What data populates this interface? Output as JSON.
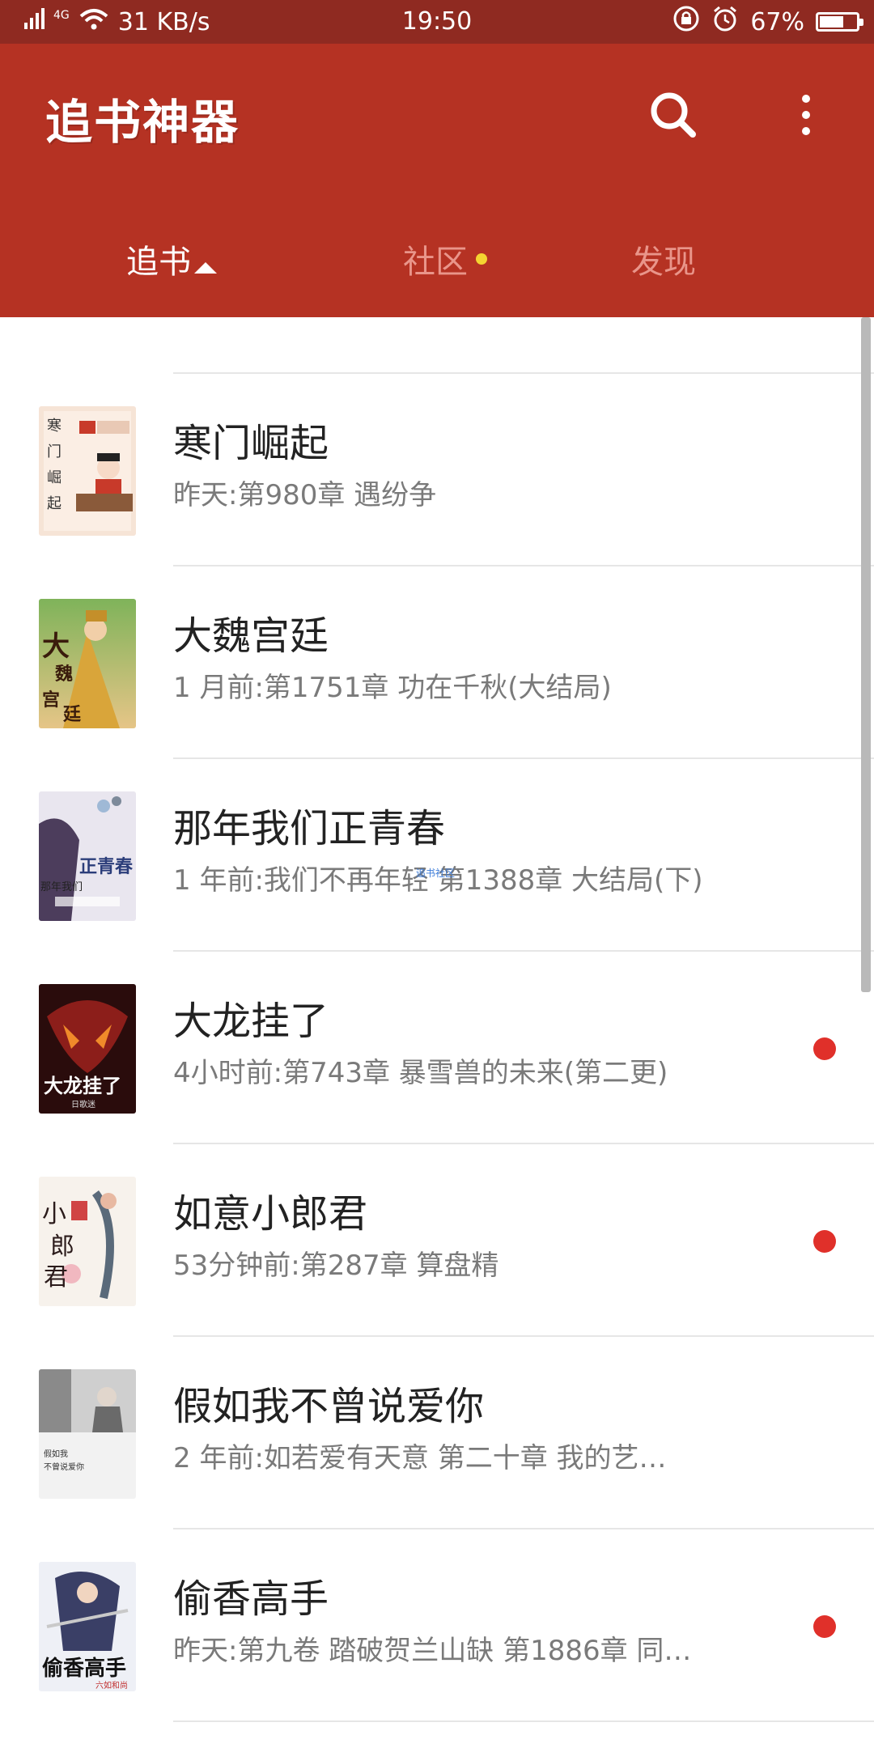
{
  "status_bar": {
    "network_type": "4G",
    "speed": "31  KB/s",
    "time": "19:50",
    "battery": "67%",
    "battery_level": 0.67
  },
  "app_bar": {
    "title": "追书神器",
    "search_icon": "search-icon",
    "more_icon": "more-vertical-icon",
    "bg_color": "#b53223"
  },
  "tabs": [
    {
      "label": "追书",
      "active": true
    },
    {
      "label": "社区",
      "active": false,
      "has_dot": true
    },
    {
      "label": "发现",
      "active": false
    }
  ],
  "watermark": "追书社区",
  "books": [
    {
      "title": "寒门崛起",
      "update": "昨天:第980章  遇纷争",
      "unread": false
    },
    {
      "title": "大魏宫廷",
      "update": "1  月前:第1751章  功在千秋(大结局)",
      "unread": false
    },
    {
      "title": "那年我们正青春",
      "update": "1  年前:我们不再年轻  第1388章  大结局(下)",
      "unread": false
    },
    {
      "title": "大龙挂了",
      "update": "4小时前:第743章  暴雪兽的未来(第二更)",
      "unread": true
    },
    {
      "title": "如意小郎君",
      "update": "53分钟前:第287章  算盘精",
      "unread": true
    },
    {
      "title": "假如我不曾说爱你",
      "update": "2  年前:如若爱有天意  第二十章    我的艺…",
      "unread": false
    },
    {
      "title": "偷香高手",
      "update": "昨天:第九卷  踏破贺兰山缺  第1886章  同…",
      "unread": true
    }
  ]
}
